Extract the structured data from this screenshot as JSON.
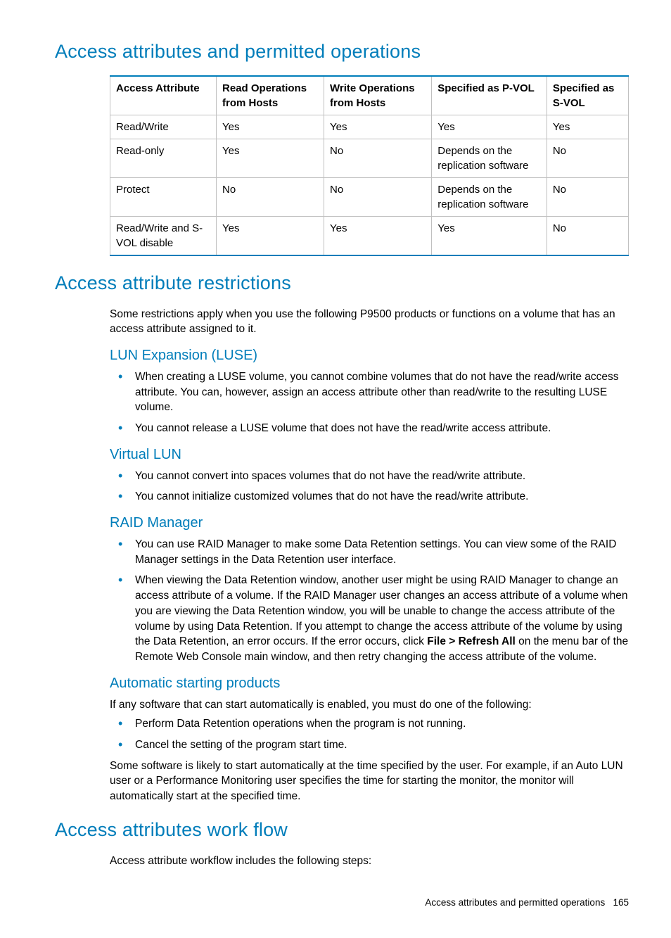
{
  "headings": {
    "h1_permitted": "Access attributes and permitted operations",
    "h1_restrictions": "Access attribute restrictions",
    "h1_workflow": "Access attributes work flow",
    "h2_luse": "LUN Expansion (LUSE)",
    "h2_vlun": "Virtual LUN",
    "h2_raid": "RAID Manager",
    "h2_auto": "Automatic starting products"
  },
  "table": {
    "headers": [
      "Access Attribute",
      "Read Operations from Hosts",
      "Write Operations from Hosts",
      "Specified as P-VOL",
      "Specified as S-VOL"
    ],
    "rows": [
      [
        "Read/Write",
        "Yes",
        "Yes",
        "Yes",
        "Yes"
      ],
      [
        "Read-only",
        "Yes",
        "No",
        "Depends on the replication software",
        "No"
      ],
      [
        "Protect",
        "No",
        "No",
        "Depends on the replication software",
        "No"
      ],
      [
        "Read/Write and S-VOL disable",
        "Yes",
        "Yes",
        "Yes",
        "No"
      ]
    ]
  },
  "paragraphs": {
    "restrictions_intro": "Some restrictions apply when you use the following P9500 products or functions on a volume that has an access attribute assigned to it.",
    "auto_intro": "If any software that can start automatically is enabled, you must do one of the following:",
    "auto_outro": "Some software is likely to start automatically at the time specified by the user. For example, if an Auto LUN user or a Performance Monitoring user specifies the time for starting the monitor, the monitor will automatically start at the specified time.",
    "workflow_intro": "Access attribute workflow includes the following steps:"
  },
  "lists": {
    "luse": [
      "When creating a LUSE volume, you cannot combine volumes that do not have the read/write access attribute. You can, however, assign an access attribute other than read/write to the resulting LUSE volume.",
      "You cannot release a LUSE volume that does not have the read/write access attribute."
    ],
    "vlun": [
      "You cannot convert into spaces volumes that do not have the read/write attribute.",
      "You cannot initialize customized volumes that do not have the read/write attribute."
    ],
    "raid": {
      "item1": "You can use RAID Manager to make some Data Retention settings. You can view some of the RAID Manager settings in the Data Retention user interface.",
      "item2_pre": "When viewing the Data Retention window, another user might be using RAID Manager to change an access attribute of a volume. If the RAID Manager user changes an access attribute of a volume when you are viewing the Data Retention window, you will be unable to change the access attribute of the volume by using Data Retention. If you attempt to change the access attribute of the volume by using the Data Retention, an error occurs. If the error occurs, click ",
      "item2_bold": "File > Refresh All",
      "item2_post": " on the menu bar of the Remote Web Console main window, and then retry changing the access attribute of the volume."
    },
    "auto": [
      "Perform Data Retention operations when the program is not running.",
      "Cancel the setting of the program start time."
    ]
  },
  "footer": {
    "text": "Access attributes and permitted operations",
    "page": "165"
  }
}
